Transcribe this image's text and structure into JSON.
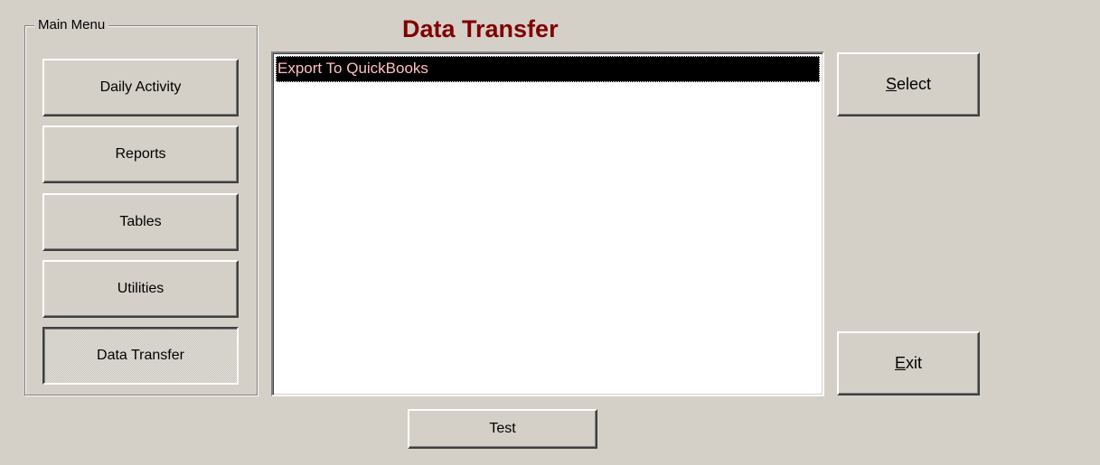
{
  "main_menu": {
    "group_label": "Main Menu",
    "buttons": [
      {
        "label": "Daily Activity"
      },
      {
        "label": "Reports"
      },
      {
        "label": "Tables"
      },
      {
        "label": "Utilities"
      },
      {
        "label": "Data Transfer"
      }
    ],
    "selected": "Data Transfer"
  },
  "title": "Data Transfer",
  "list": {
    "items": [
      {
        "label": "Export To QuickBooks"
      }
    ],
    "selected_index": 0
  },
  "actions": {
    "select": {
      "mnemonic": "S",
      "rest": "elect"
    },
    "exit": {
      "mnemonic": "E",
      "rest": "xit"
    },
    "test": "Test"
  },
  "colors": {
    "title": "#800000",
    "background": "#d4d0c8",
    "selection_bg": "#000000",
    "selection_text": "#ffc0c0"
  }
}
